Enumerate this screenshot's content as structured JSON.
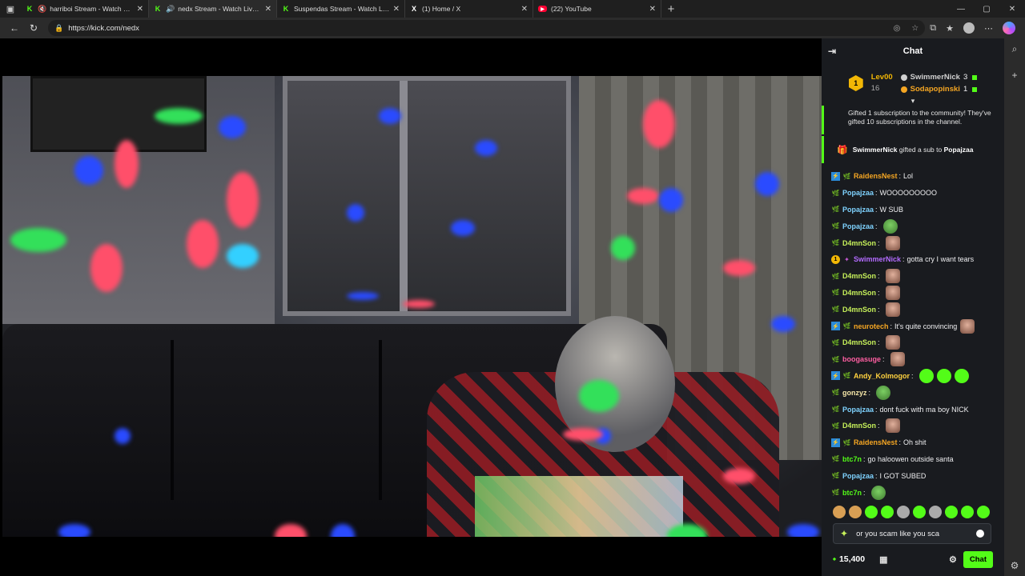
{
  "browser": {
    "tabs": [
      {
        "title": "harriboi Stream - Watch Live o",
        "icon": "kick",
        "muted": true,
        "active": false
      },
      {
        "title": "nedx Stream - Watch Live on",
        "icon": "kick",
        "muted": false,
        "active": true
      },
      {
        "title": "Suspendas Stream - Watch Live o",
        "icon": "kick",
        "muted": false,
        "active": false
      },
      {
        "title": "(1) Home / X",
        "icon": "x",
        "muted": false,
        "active": false
      },
      {
        "title": "(22) YouTube",
        "icon": "youtube",
        "muted": false,
        "active": false
      }
    ],
    "url": "https://kick.com/nedx"
  },
  "chat": {
    "title": "Chat",
    "leaderboard": {
      "top": {
        "name": "Lev00",
        "count": "16",
        "rank": "1"
      },
      "others": [
        {
          "name": "SwimmerNick",
          "count": "3",
          "color": "#d0d0d0"
        },
        {
          "name": "Sodapopinski",
          "count": "1",
          "color": "#f5a623"
        }
      ]
    },
    "system_message": "Gifted 1 subscription to the community! They've gifted 10 subscriptions in the channel.",
    "sub_gift": {
      "gifter": "SwimmerNick",
      "action": "gifted a sub to",
      "recipient": "Popajzaa"
    },
    "messages": [
      {
        "badges": [
          "vip",
          "plant"
        ],
        "user": "RaidensNest",
        "color": "#f5a623",
        "text": "Lol",
        "emotes": []
      },
      {
        "badges": [
          "plant"
        ],
        "user": "Popajzaa",
        "color": "#7fd3ff",
        "text": "WOOOOOOOOO",
        "emotes": []
      },
      {
        "badges": [
          "plant"
        ],
        "user": "Popajzaa",
        "color": "#7fd3ff",
        "text": "W SUB",
        "emotes": []
      },
      {
        "badges": [
          "plant"
        ],
        "user": "Popajzaa",
        "color": "#7fd3ff",
        "text": "",
        "emotes": [
          "pepe"
        ]
      },
      {
        "badges": [
          "plant"
        ],
        "user": "D4mnSon",
        "color": "#c6f05a",
        "text": "",
        "emotes": [
          "face"
        ]
      },
      {
        "badges": [
          "sub1",
          "gifter"
        ],
        "user": "SwimmerNick",
        "color": "#b36bff",
        "text": "gotta cry I want tears",
        "emotes": []
      },
      {
        "badges": [
          "plant"
        ],
        "user": "D4mnSon",
        "color": "#c6f05a",
        "text": "",
        "emotes": [
          "face"
        ]
      },
      {
        "badges": [
          "plant"
        ],
        "user": "D4mnSon",
        "color": "#c6f05a",
        "text": "",
        "emotes": [
          "face"
        ]
      },
      {
        "badges": [
          "plant"
        ],
        "user": "D4mnSon",
        "color": "#c6f05a",
        "text": "",
        "emotes": [
          "face"
        ]
      },
      {
        "badges": [
          "vip",
          "plant"
        ],
        "user": "neurotech",
        "color": "#f5a623",
        "text": "It's quite convincing",
        "emotes": [
          "face"
        ]
      },
      {
        "badges": [
          "plant"
        ],
        "user": "D4mnSon",
        "color": "#c6f05a",
        "text": "",
        "emotes": [
          "face"
        ]
      },
      {
        "badges": [
          "plant"
        ],
        "user": "boogasuge",
        "color": "#ff5fa2",
        "text": "",
        "emotes": [
          "face"
        ]
      },
      {
        "badges": [
          "vip",
          "plant"
        ],
        "user": "Andy_Kolmogor",
        "color": "#ffd23f",
        "text": "",
        "emotes": [
          "kick",
          "kick",
          "kick"
        ]
      },
      {
        "badges": [
          "plant"
        ],
        "user": "gonzyz",
        "color": "#f5e6a8",
        "text": "",
        "emotes": [
          "pepe"
        ]
      },
      {
        "badges": [
          "plant"
        ],
        "user": "Popajzaa",
        "color": "#7fd3ff",
        "text": "dont fuck with ma boy NICK",
        "emotes": []
      },
      {
        "badges": [
          "plant"
        ],
        "user": "D4mnSon",
        "color": "#c6f05a",
        "text": "",
        "emotes": [
          "face"
        ]
      },
      {
        "badges": [
          "vip",
          "plant"
        ],
        "user": "RaidensNest",
        "color": "#f5a623",
        "text": "Oh shit",
        "emotes": []
      },
      {
        "badges": [
          "plant"
        ],
        "user": "btc7n",
        "color": "#53fc18",
        "text": "go haloowen outside santa",
        "emotes": []
      },
      {
        "badges": [
          "plant"
        ],
        "user": "Popajzaa",
        "color": "#7fd3ff",
        "text": "I GOT SUBED",
        "emotes": []
      },
      {
        "badges": [
          "plant"
        ],
        "user": "btc7n",
        "color": "#53fc18",
        "text": "",
        "emotes": [
          "pepe"
        ]
      }
    ],
    "input_value": "or you scam like you sca",
    "points": "15,400",
    "send_label": "Chat"
  }
}
